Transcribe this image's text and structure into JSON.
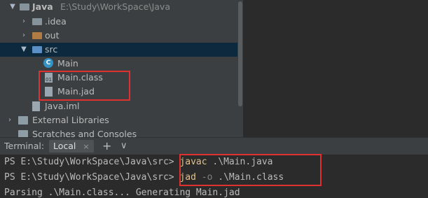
{
  "project_tree": {
    "root": {
      "name": "Java",
      "path": "E:\\Study\\WorkSpace\\Java"
    },
    "items": [
      {
        "label": "Java",
        "path": "E:\\Study\\WorkSpace\\Java"
      },
      {
        "label": ".idea"
      },
      {
        "label": "out"
      },
      {
        "label": "src"
      },
      {
        "label": "Main"
      },
      {
        "label": "Main.class"
      },
      {
        "label": "Main.jad"
      },
      {
        "label": "Java.iml"
      },
      {
        "label": "External Libraries"
      },
      {
        "label": "Scratches and Consoles"
      }
    ]
  },
  "terminal": {
    "title": "Terminal:",
    "tab_label": "Local",
    "tab_close": "×",
    "add_tab": "+",
    "dropdown": "∨",
    "lines": [
      {
        "prompt": "PS E:\\Study\\WorkSpace\\Java\\src> ",
        "cmd": "javac",
        "opt": "",
        "arg": " .\\Main.java"
      },
      {
        "prompt": "PS E:\\Study\\WorkSpace\\Java\\src> ",
        "cmd": "jad",
        "opt": " -o",
        "arg": " .\\Main.class"
      },
      {
        "text": "Parsing .\\Main.class... Generating Main.jad"
      }
    ]
  },
  "colors": {
    "highlight_box": "#e03131",
    "selected_row": "#0d293e",
    "panel_bg": "#3c3f41",
    "terminal_bg": "#2b2b2b"
  }
}
